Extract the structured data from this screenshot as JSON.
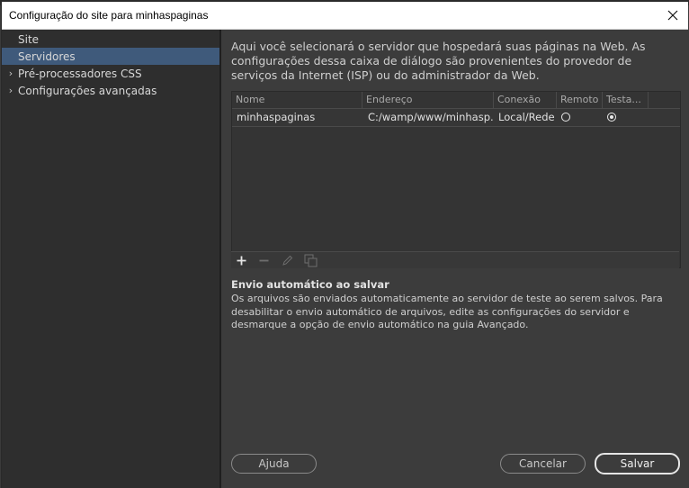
{
  "dialog": {
    "title": "Configuração do site para minhaspaginas"
  },
  "sidebar": {
    "items": [
      {
        "label": "Site",
        "expandable": false,
        "selected": false
      },
      {
        "label": "Servidores",
        "expandable": false,
        "selected": true
      },
      {
        "label": "Pré-processadores CSS",
        "expandable": true,
        "selected": false
      },
      {
        "label": "Configurações avançadas",
        "expandable": true,
        "selected": false
      }
    ]
  },
  "main": {
    "intro": "Aqui você selecionará o servidor que hospedará suas páginas na Web. As configurações dessa caixa de diálogo são provenientes do provedor de serviços da Internet (ISP) ou do administrador da Web.",
    "table": {
      "columns": [
        "Nome",
        "Endereço",
        "Conexão",
        "Remoto",
        "Testa..."
      ],
      "rows": [
        {
          "nome": "minhaspaginas",
          "endereco": "C:/wamp/www/minhasp...",
          "conexao": "Local/Rede",
          "remoto": false,
          "teste": true
        }
      ]
    },
    "toolbar": {
      "icons": [
        "plus-icon",
        "minus-icon",
        "pencil-icon",
        "duplicate-icon"
      ]
    },
    "auto_upload": {
      "title": "Envio automático ao salvar",
      "text": "Os arquivos são enviados automaticamente ao servidor de teste ao serem salvos. Para desabilitar o envio automático de arquivos, edite as configurações do servidor e desmarque a opção de envio automático na guia Avançado."
    }
  },
  "buttons": {
    "help": "Ajuda",
    "cancel": "Cancelar",
    "save": "Salvar"
  }
}
